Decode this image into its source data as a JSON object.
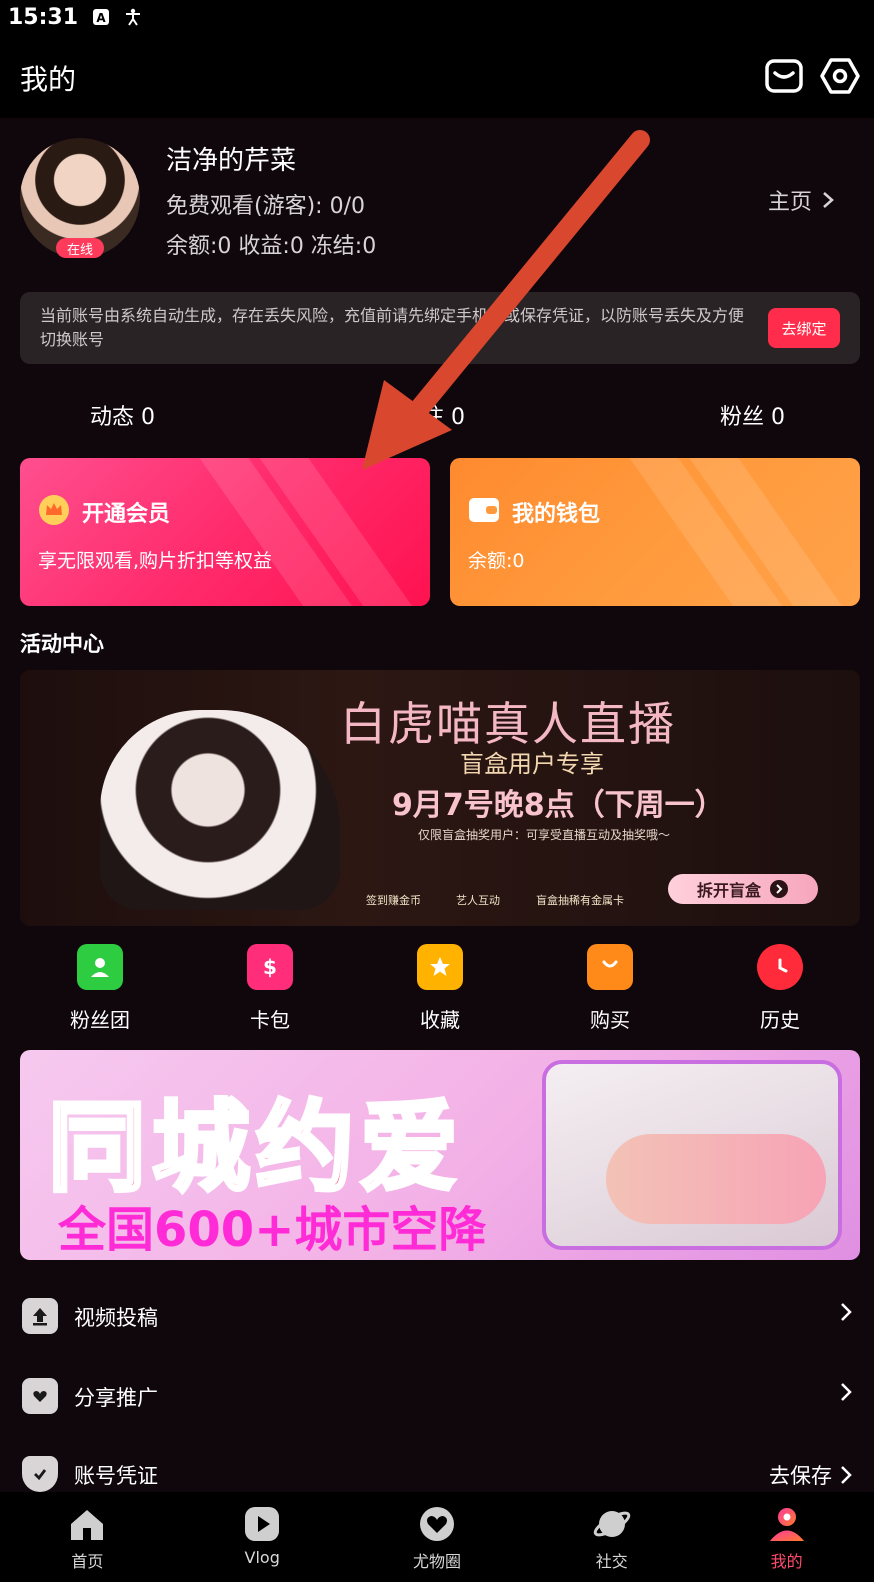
{
  "status_bar": {
    "time": "15:31"
  },
  "header": {
    "title": "我的"
  },
  "profile": {
    "online_badge": "在线",
    "username": "洁净的芹菜",
    "free_watch": "免费观看(游客): 0/0",
    "balance_line": "余额:0 收益:0 冻结:0",
    "homepage_label": "主页"
  },
  "notice": {
    "text": "当前账号由系统自动生成，存在丢失风险，充值前请先绑定手机号或保存凭证，以防账号丢失及方便切换账号",
    "button": "去绑定"
  },
  "stats": {
    "dynamic": "动态 0",
    "follow": "关注 0",
    "fans": "粉丝 0"
  },
  "vip_card": {
    "title": "开通会员",
    "subtitle": "享无限观看,购片折扣等权益"
  },
  "wallet_card": {
    "title": "我的钱包",
    "subtitle": "余额:0"
  },
  "activity": {
    "title": "活动中心",
    "banner1": {
      "title": "白虎喵真人直播",
      "subtitle": "盲盒用户专享",
      "date": "9月7号晚8点（下周一）",
      "note": "仅限盲盒抽奖用户：可享受直播互动及抽奖哦～",
      "features": [
        "签到赚金币",
        "艺人互动",
        "盲盒抽稀有金属卡"
      ],
      "button": "拆开盲盒"
    }
  },
  "quick_links": [
    {
      "label": "粉丝团",
      "icon": "fan-group-icon",
      "color": "#2ecc40"
    },
    {
      "label": "卡包",
      "icon": "card-wallet-icon",
      "color": "#ff2d7a"
    },
    {
      "label": "收藏",
      "icon": "favorite-icon",
      "color": "#ffb300"
    },
    {
      "label": "购买",
      "icon": "shopping-bag-icon",
      "color": "#ff8a1a"
    },
    {
      "label": "历史",
      "icon": "history-clock-icon",
      "color": "#ff2b3a"
    }
  ],
  "banner2": {
    "title": "同城约爱",
    "subtitle": "全国600+城市空降"
  },
  "menu": [
    {
      "label": "视频投稿",
      "right": ""
    },
    {
      "label": "分享推广",
      "right": ""
    },
    {
      "label": "账号凭证",
      "right": "去保存"
    }
  ],
  "tabs": [
    {
      "label": "首页"
    },
    {
      "label": "Vlog"
    },
    {
      "label": "尤物圈"
    },
    {
      "label": "社交"
    },
    {
      "label": "我的"
    }
  ],
  "colors": {
    "accent": "#ff4a6e",
    "vip_gradient_end": "#ff1250",
    "wallet": "#ff9a3c",
    "annotation_arrow": "#d9472f"
  }
}
